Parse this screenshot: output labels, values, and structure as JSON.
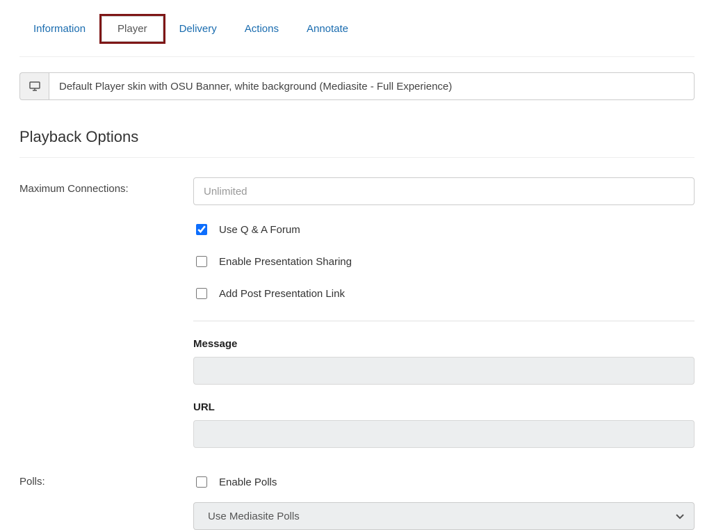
{
  "tabs": {
    "information": "Information",
    "player": "Player",
    "delivery": "Delivery",
    "actions": "Actions",
    "annotate": "Annotate"
  },
  "skin": {
    "value": "Default Player skin with OSU Banner, white background (Mediasite - Full Experience)"
  },
  "section_playback_title": "Playback Options",
  "max_connections_label": "Maximum Connections:",
  "max_connections_placeholder": "Unlimited",
  "checks": {
    "qa": "Use Q & A Forum",
    "sharing": "Enable Presentation Sharing",
    "postlink": "Add Post Presentation Link"
  },
  "message_label": "Message",
  "url_label": "URL",
  "polls_label": "Polls:",
  "enable_polls_label": "Enable Polls",
  "polls_select_value": "Use Mediasite Polls"
}
